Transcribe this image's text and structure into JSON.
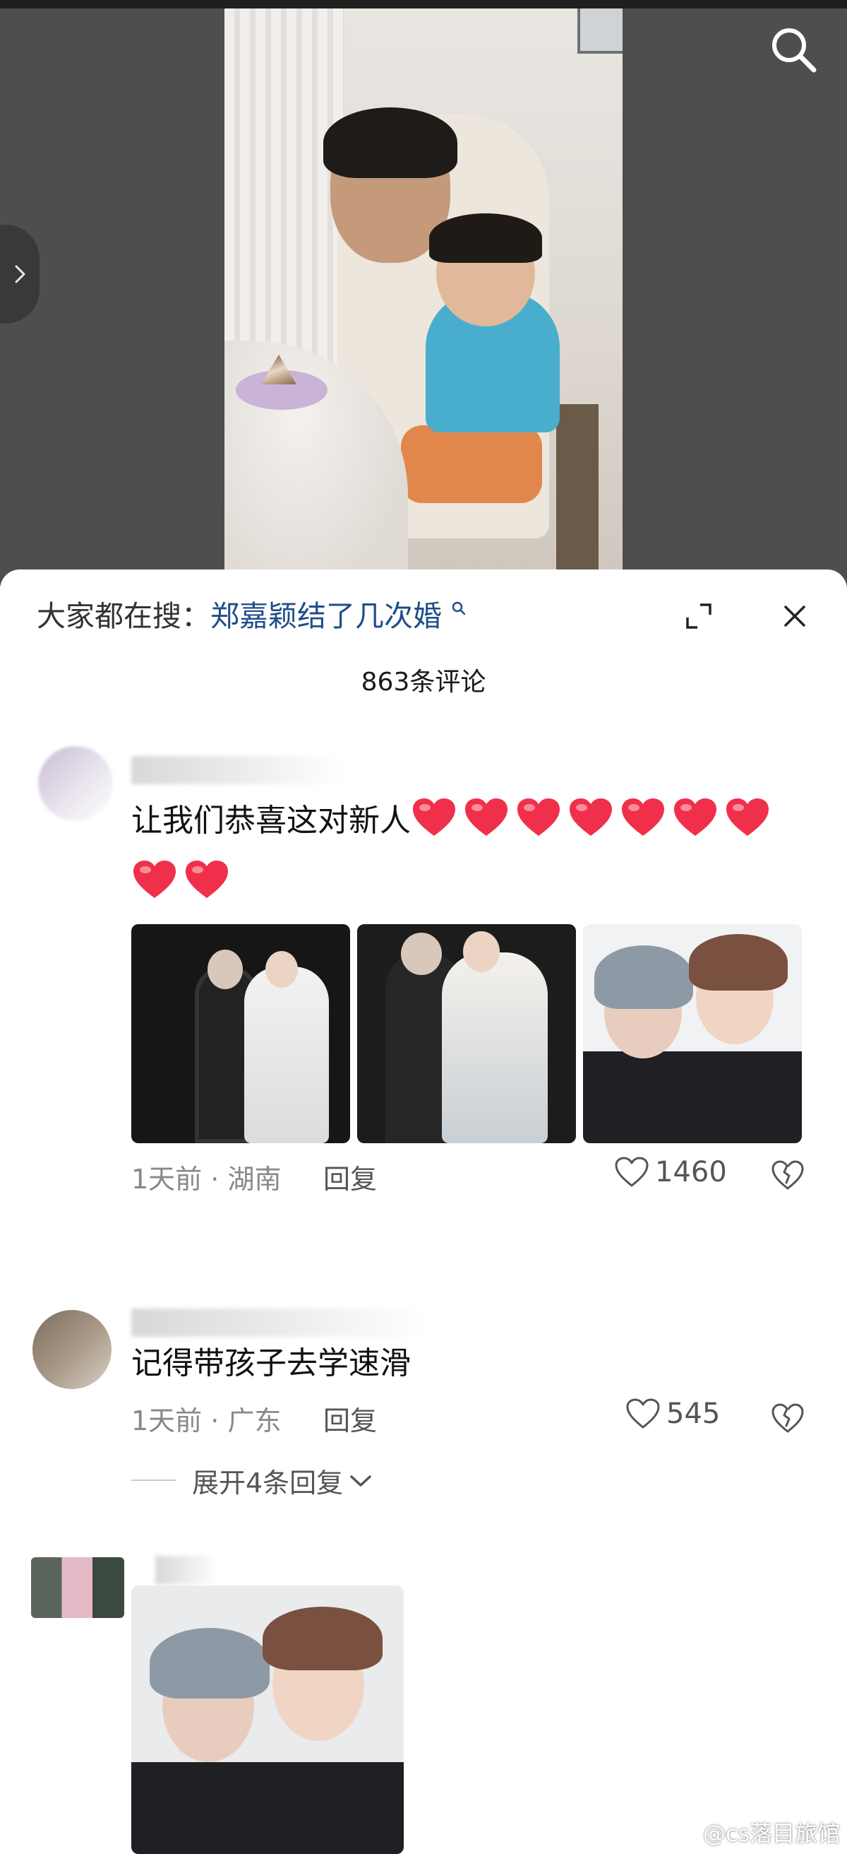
{
  "search": {
    "trending_prefix": "大家都在搜：",
    "trending_term": "郑嘉颖结了几次婚"
  },
  "comments_header": {
    "count_label": "863条评论"
  },
  "comments": [
    {
      "text": "让我们恭喜这对新人",
      "time": "1天前",
      "separator": "·",
      "location": "湖南",
      "reply_label": "回复",
      "likes": "1460",
      "heart_count": 9
    },
    {
      "text": "记得带孩子去学速滑",
      "time": "1天前",
      "separator": "·",
      "location": "广东",
      "reply_label": "回复",
      "likes": "545",
      "expand_label": "展开4条回复"
    }
  ],
  "watermark": "@cs落目旅馆",
  "colors": {
    "link": "#1f4e89",
    "heart": "#f0304a",
    "meta": "#888888"
  }
}
